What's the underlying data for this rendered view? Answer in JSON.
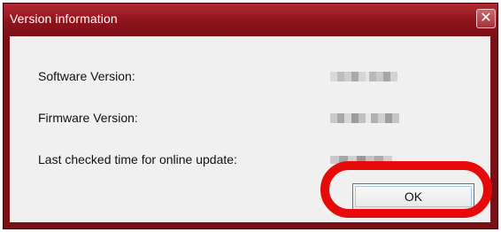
{
  "dialog": {
    "title": "Version information",
    "close_glyph": "✕",
    "close_icon": "close-icon",
    "rows": [
      {
        "label": "Software Version:"
      },
      {
        "label": "Firmware Version:"
      },
      {
        "label": "Last checked time for online update:"
      }
    ],
    "ok_label": "OK"
  },
  "colors": {
    "titlebar": "#8e141d",
    "content_bg": "#f0f0f0",
    "highlight_ring": "#e60a0a"
  }
}
